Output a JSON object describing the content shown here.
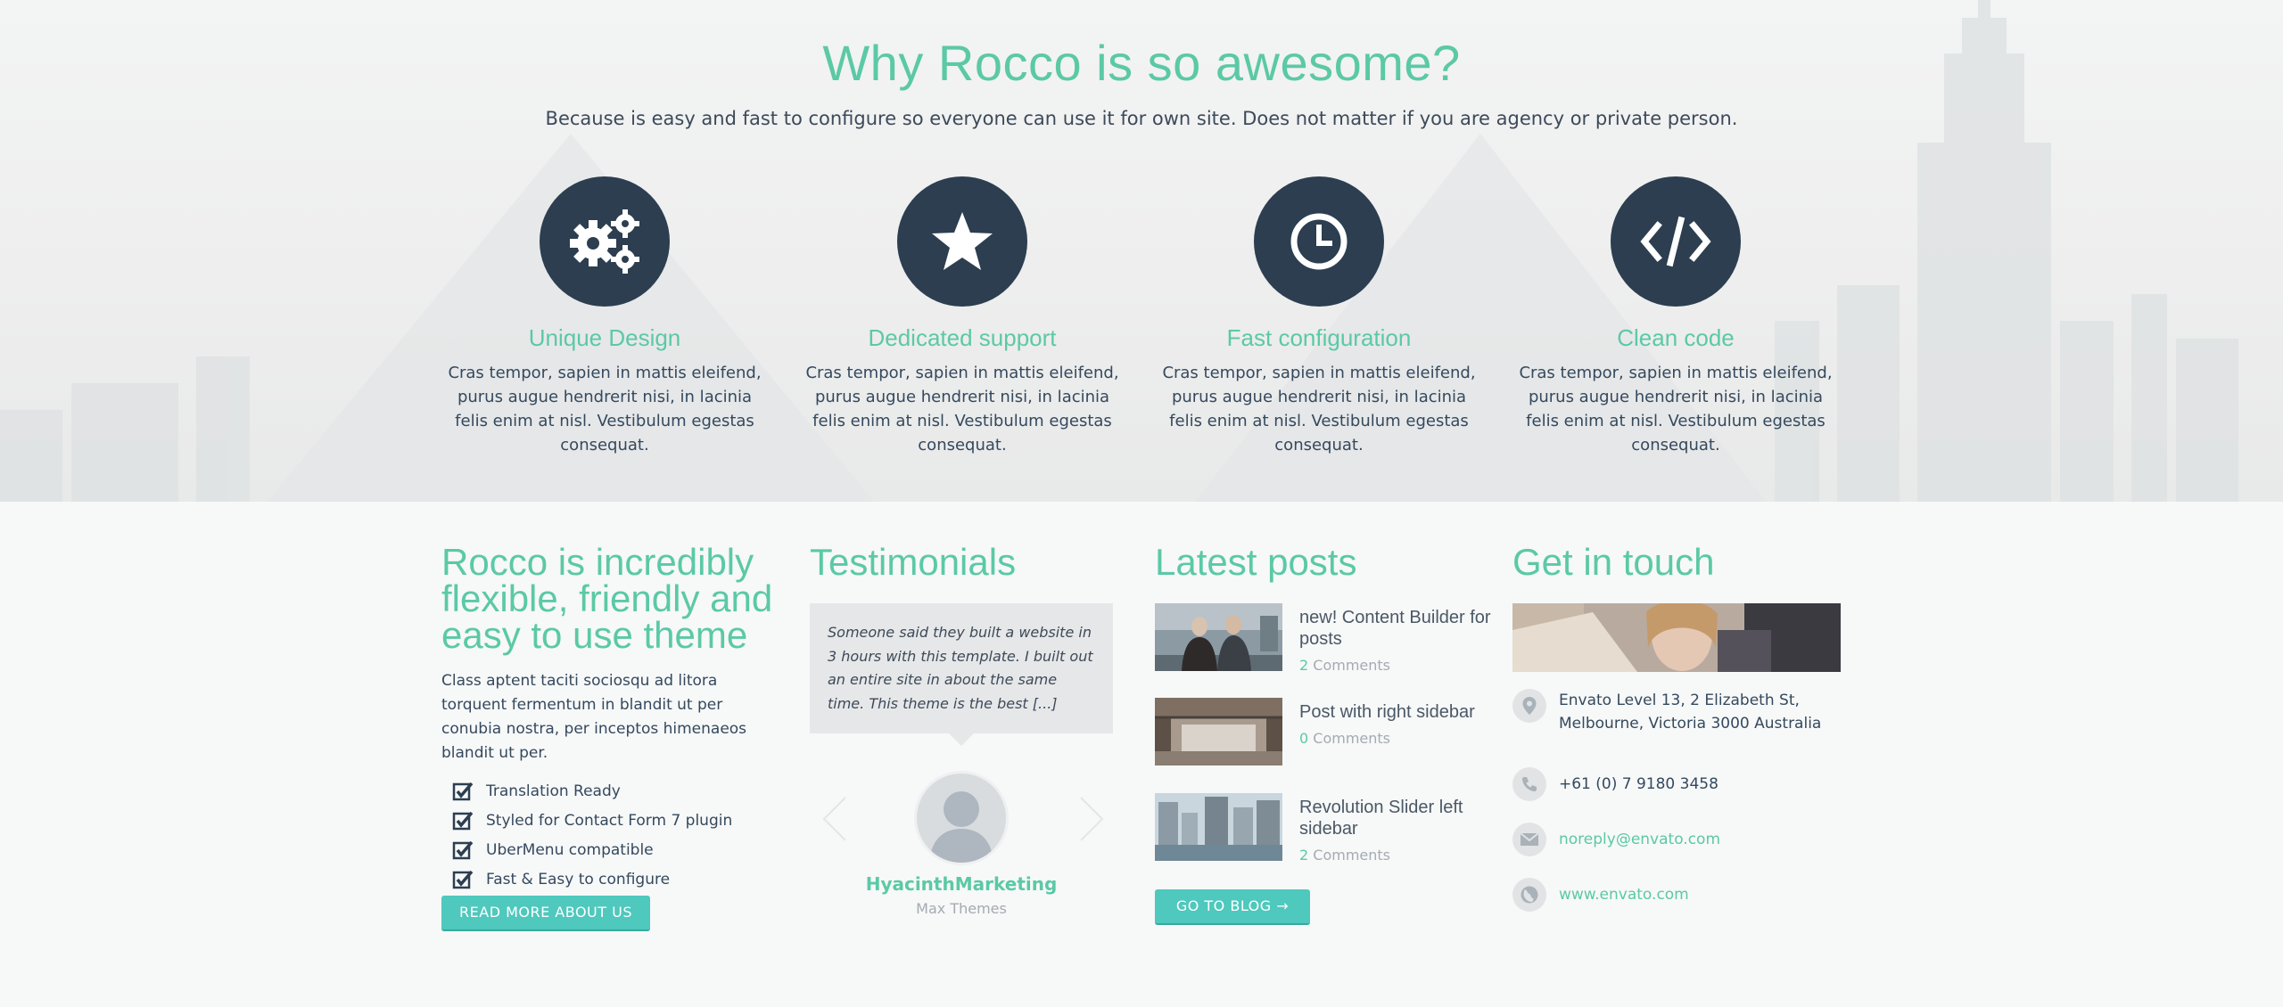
{
  "hero": {
    "title": "Why Rocco is so awesome?",
    "subtitle": "Because is easy and fast to configure so everyone can use it for own site. Does not matter if you are agency or private person.",
    "features": [
      {
        "icon": "gears-icon",
        "title": "Unique Design",
        "text": "Cras tempor, sapien in mattis eleifend, purus augue hendrerit nisi, in lacinia felis enim at nisl. Vestibulum egestas consequat."
      },
      {
        "icon": "star-icon",
        "title": "Dedicated support",
        "text": "Cras tempor, sapien in mattis eleifend, purus augue hendrerit nisi, in lacinia felis enim at nisl. Vestibulum egestas consequat."
      },
      {
        "icon": "clock-icon",
        "title": "Fast configuration",
        "text": "Cras tempor, sapien in mattis eleifend, purus augue hendrerit nisi, in lacinia felis enim at nisl. Vestibulum egestas consequat."
      },
      {
        "icon": "code-icon",
        "title": "Clean code",
        "text": "Cras tempor, sapien in mattis eleifend, purus augue hendrerit nisi, in lacinia felis enim at nisl. Vestibulum egestas consequat."
      }
    ]
  },
  "about": {
    "title": "Rocco is incredibly flexible, friendly and easy to use theme",
    "text": "Class aptent taciti sociosqu ad litora torquent fermentum in blandit ut per conubia nostra, per inceptos himenaeos blandit ut per.",
    "checklist": [
      "Translation Ready",
      "Styled for Contact Form 7 plugin",
      "UberMenu compatible",
      "Fast & Easy to configure"
    ],
    "button_label": "READ MORE ABOUT US"
  },
  "testimonials": {
    "title": "Testimonials",
    "quote": "Someone said they built a website in 3 hours with this template. I built out an entire site in about the same time. This theme is the best [...]",
    "name": "HyacinthMarketing",
    "company": "Max Themes"
  },
  "posts": {
    "title": "Latest posts",
    "items": [
      {
        "title": "new! Content Builder for posts",
        "comment_count": "2",
        "comment_label": " Comments"
      },
      {
        "title": "Post with right sidebar",
        "comment_count": "0",
        "comment_label": " Comments"
      },
      {
        "title": "Revolution Slider left sidebar",
        "comment_count": "2",
        "comment_label": " Comments"
      }
    ],
    "button_label": "GO TO BLOG →"
  },
  "contact": {
    "title": "Get in touch",
    "address": "Envato Level 13, 2 Elizabeth St, Melbourne, Victoria 3000 Australia",
    "phone": "+61 (0) 7 9180 3458",
    "email": "noreply@envato.com",
    "website": "www.envato.com"
  },
  "colors": {
    "accent": "#5bc9a5",
    "dark": "#2c3e50",
    "button": "#4fc8bd"
  }
}
